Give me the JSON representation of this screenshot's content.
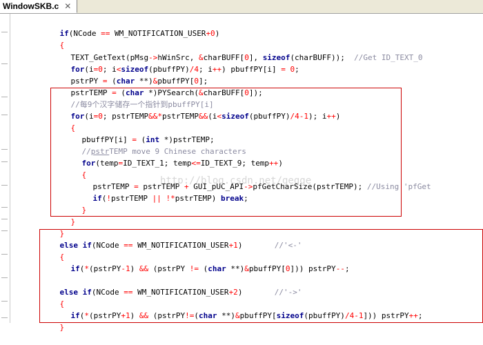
{
  "tab": {
    "title": "WindowSKB.c",
    "close": "✕"
  },
  "watermark": "http://blog.csdn.net/gegge",
  "colors": {
    "keyword": "#00008b",
    "number": "#ff0000",
    "comment": "#8a8aa0",
    "box": "#cc0000"
  },
  "code": {
    "l1": [
      "if",
      "(NCode ",
      "==",
      " WM_NOTIFICATION_USER",
      "+0",
      ")"
    ],
    "l2": [
      "{"
    ],
    "l3": [
      "TEXT_GetText(pMsg",
      "->",
      "hWinSrc, ",
      "&",
      "charBUFF[",
      "0",
      "], ",
      "sizeof",
      "(charBUFF));  ",
      "//Get ID_TEXT_0"
    ],
    "l4": [
      "for",
      "(i",
      "=",
      "0",
      "; i",
      "<",
      "sizeof",
      "(pbuffPY)",
      "/",
      "4",
      "; i",
      "++",
      ") pbuffPY[i] ",
      "=",
      " ",
      "0",
      ";"
    ],
    "l5": [
      "pstrPY ",
      "=",
      " (",
      "char",
      " **)",
      "&",
      "pbuffPY[",
      "0",
      "];"
    ],
    "l6": [
      "pstrTEMP ",
      "=",
      " (",
      "char",
      " *)PYSearch(",
      "&",
      "charBUFF[",
      "0",
      "]);"
    ],
    "l7": [
      "//每9个汉字储存一个指针到pbuffPY[i]"
    ],
    "l8": [
      "for",
      "(i",
      "=",
      "0",
      "; pstrTEMP",
      "&&",
      "*",
      "pstrTEMP",
      "&&",
      "(i",
      "<",
      "sizeof",
      "(pbuffPY)",
      "/",
      "4",
      "-",
      "1",
      "); i",
      "++",
      ")"
    ],
    "l9": [
      "{"
    ],
    "l10": [
      "pbuffPY[i] ",
      "=",
      " (",
      "int",
      " *)pstrTEMP;"
    ],
    "l11": [
      "//",
      "pstr",
      "TEMP move 9 Chinese characters"
    ],
    "l12": [
      "for",
      "(temp",
      "=",
      "ID_TEXT_1; temp",
      "<=",
      "ID_TEXT_9; temp",
      "++",
      ")"
    ],
    "l13": [
      "{"
    ],
    "l14": [
      "pstrTEMP ",
      "=",
      " pstrTEMP ",
      "+",
      " GUI_pUC_API",
      "->",
      "pfGetCharSize(pstrTEMP); ",
      "//Using 'pfGet"
    ],
    "l15": [
      "if",
      "(",
      "!",
      "pstrTEMP ",
      "||",
      " ",
      "!",
      "*",
      "pstrTEMP) ",
      "break",
      ";"
    ],
    "l16": [
      "}"
    ],
    "l17": [
      "}"
    ],
    "l18": [
      "}"
    ],
    "l19": [
      "else",
      " ",
      "if",
      "(NCode ",
      "==",
      " WM_NOTIFICATION_USER",
      "+1",
      ")       ",
      "//'<-'"
    ],
    "l20": [
      "{"
    ],
    "l21": [
      "if",
      "(",
      "*",
      "(pstrPY",
      "-1",
      ") ",
      "&&",
      " (pstrPY ",
      "!=",
      " (",
      "char",
      " **)",
      "&",
      "pbuffPY[",
      "0",
      "])) pstrPY",
      "--",
      ";"
    ],
    "l22": [
      "else",
      " ",
      "if",
      "(NCode ",
      "==",
      " WM_NOTIFICATION_USER",
      "+2",
      ")       ",
      "//'->'"
    ],
    "l23": [
      "{"
    ],
    "l24": [
      "if",
      "(",
      "*",
      "(pstrPY",
      "+1",
      ") ",
      "&&",
      " (pstrPY",
      "!=",
      "(",
      "char",
      " **)",
      "&",
      "pbuffPY[",
      "sizeof",
      "(pbuffPY)",
      "/",
      "4",
      "-",
      "1",
      "])) pstrPY",
      "++",
      ";"
    ],
    "l25": [
      "}"
    ]
  }
}
